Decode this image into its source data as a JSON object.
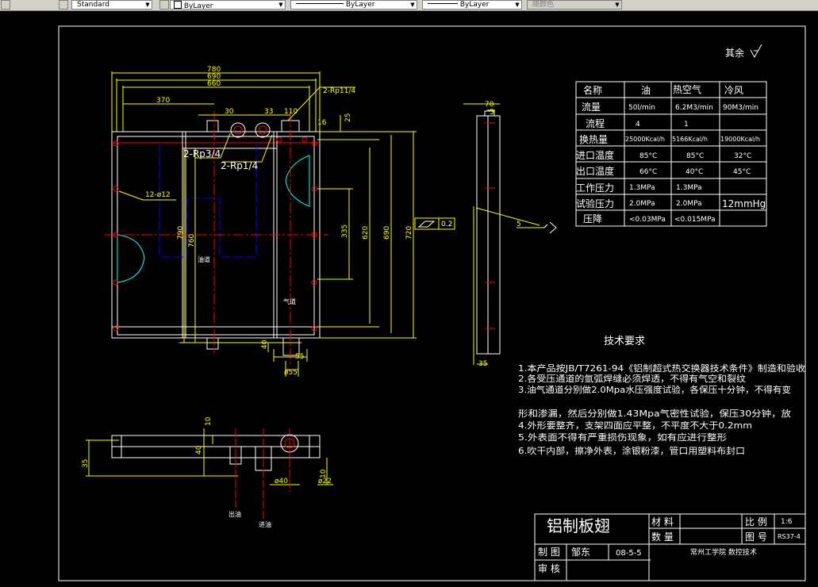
{
  "toolbar": {
    "text_style": "Standard",
    "layer_color": "ByLayer",
    "linetype": "ByLayer",
    "lineweight": "ByLayer",
    "plot_style": "随颜色"
  },
  "drawing": {
    "surface_note": "其余",
    "dims": {
      "d780": "780",
      "d690": "690",
      "d660": "660",
      "d370": "370",
      "d30": "30",
      "d33": "33",
      "d110": "110",
      "d16": "16",
      "d25": "25",
      "rp11_4": "2-Rp11/4",
      "rp3_4": "2-Rp3/4",
      "rp1_4": "2-Rp1/4",
      "hole12": "12-ø12",
      "d790": "790",
      "d760": "760",
      "d335": "335",
      "d620": "620",
      "d690v": "690",
      "d720": "720",
      "d40": "40",
      "d55": "55",
      "phi55": "ø55",
      "d70": "70",
      "d5": "5",
      "d35": "35",
      "d5b": "5",
      "tol": "0.2",
      "d10": "10",
      "d40b": "40",
      "d35b": "35",
      "phi40": "ø40",
      "phi22": "ø22",
      "d10b": "10"
    },
    "labels": {
      "oil_path": "油道",
      "air_path": "气道",
      "oil_out": "出油",
      "oil_in": "进油"
    }
  },
  "spec_table": {
    "headers": [
      "名称",
      "油",
      "热空气",
      "冷风"
    ],
    "rows": [
      [
        "流量",
        "50l/min",
        "6.2M3/min",
        "90M3/min"
      ],
      [
        "流程",
        "4",
        "1",
        ""
      ],
      [
        "换热量",
        "25000Kcal/h",
        "5166Kcal/h",
        "19000Kcal/h"
      ],
      [
        "进口温度",
        "85°C",
        "85°C",
        "32°C"
      ],
      [
        "出口温度",
        "66°C",
        "40°C",
        "45°C"
      ],
      [
        "工作压力",
        "1.3MPa",
        "1.3MPa",
        ""
      ],
      [
        "试验压力",
        "2.0MPa",
        "2.0MPa",
        "12mmHg"
      ],
      [
        "压降",
        "<0.03MPa",
        "<0.015MPa",
        ""
      ]
    ]
  },
  "tech_req": {
    "title": "技术要求",
    "lines": [
      "1.本产品按JB/T7261-94《铝制超式热交换器技术条件》制造和验收",
      "2.各受压通道的氩弧焊缝必须焊透，不得有气空和裂纹",
      "3.油气通道分别做2.0Mpa水压强度试验，各保压十分钟，不得有变",
      "   形和渗漏，然后分别做1.43Mpa气密性试验，保压30分钟，放",
      "4.外形要整齐，支架四面应平整，不平度不大于0.2mm",
      "5.外表面不得有严重损伤现象，如有应进行整形",
      "6.吹干内部，擦净外表，涂银粉漆，管口用塑料布封口"
    ]
  },
  "title_block": {
    "name": "铝制板翅",
    "material_label": "材 料",
    "quantity_label": "数 量",
    "scale_label": "比 例",
    "scale_value": "1:6",
    "drawing_no_label": "图 号",
    "drawing_no": "RS37-4",
    "drawn_by_label": "制 图",
    "drawn_by": "邹东",
    "date": "08-5-5",
    "reviewed_label": "审 核",
    "institution": "常州工学院  数控技术"
  }
}
